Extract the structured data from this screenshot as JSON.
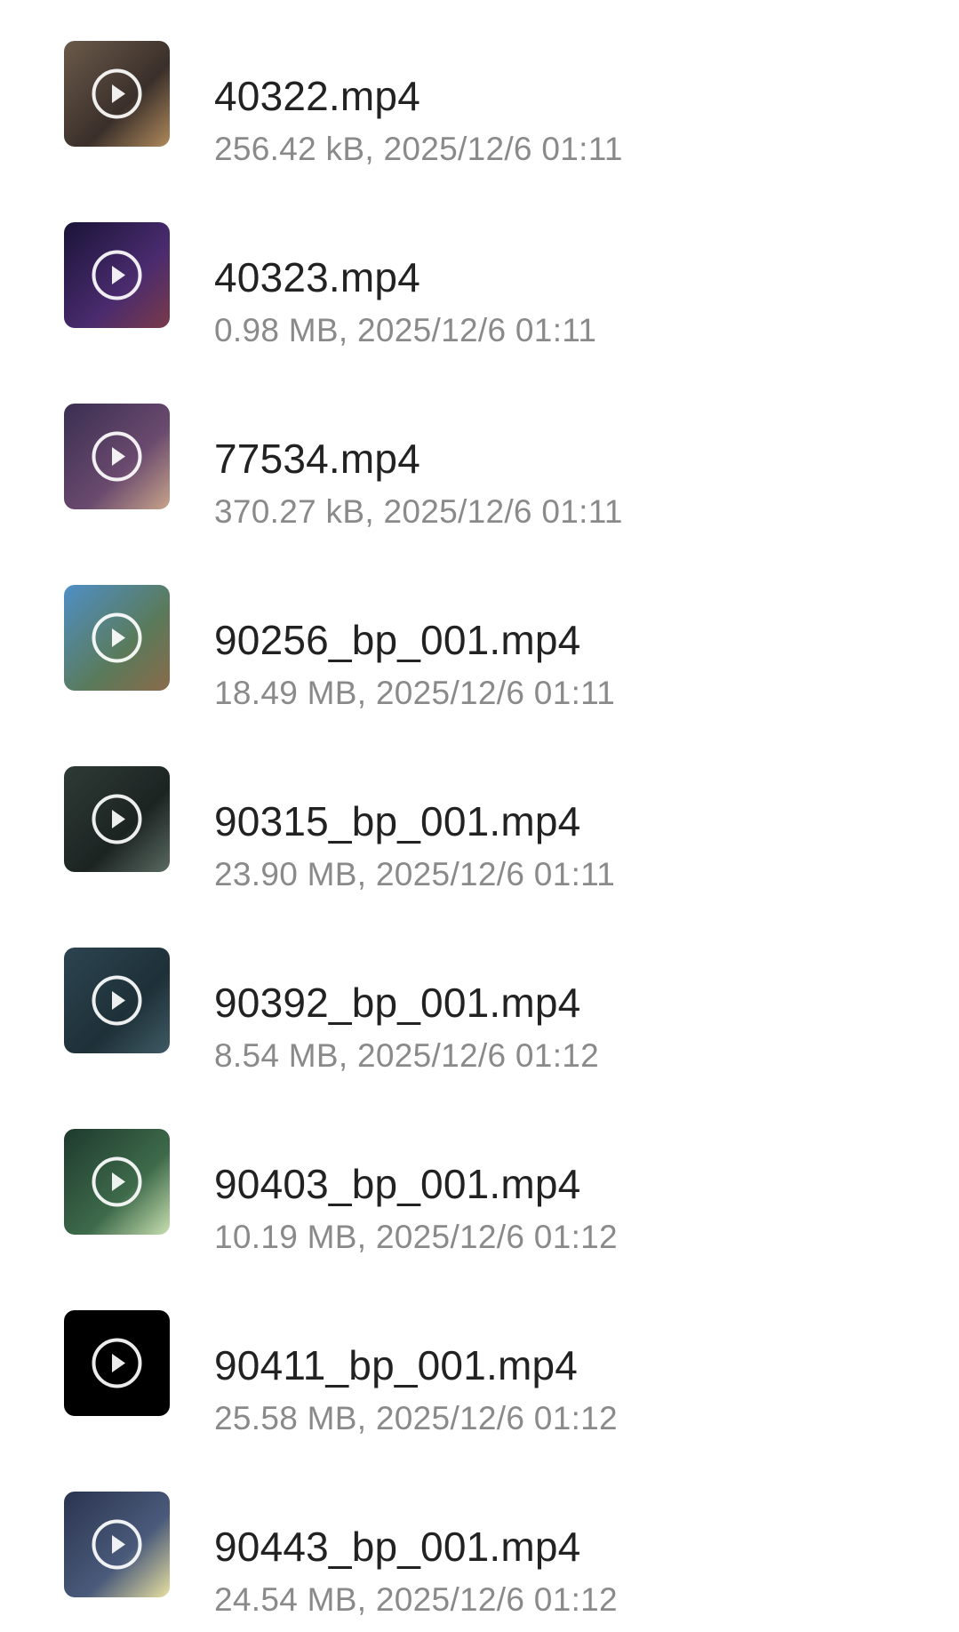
{
  "files": [
    {
      "name": "40322.mp4",
      "meta": "256.42 kB, 2025/12/6 01:11",
      "thumb_icon": "video-thumbnail-icon",
      "thumb_colors": [
        "#6b5a4a",
        "#3a2f2a",
        "#b08a5c"
      ]
    },
    {
      "name": "40323.mp4",
      "meta": "0.98 MB, 2025/12/6 01:11",
      "thumb_icon": "video-thumbnail-icon",
      "thumb_colors": [
        "#1a1438",
        "#4a2b6e",
        "#7a3a4a"
      ]
    },
    {
      "name": "77534.mp4",
      "meta": "370.27 kB, 2025/12/6 01:11",
      "thumb_icon": "video-thumbnail-icon",
      "thumb_colors": [
        "#3a2f52",
        "#6a4a6e",
        "#c9a48a"
      ]
    },
    {
      "name": "90256_bp_001.mp4",
      "meta": "18.49 MB, 2025/12/6 01:11",
      "thumb_icon": "video-thumbnail-icon",
      "thumb_colors": [
        "#4f8fc6",
        "#5a7a5a",
        "#8a6a4a"
      ]
    },
    {
      "name": "90315_bp_001.mp4",
      "meta": "23.90 MB, 2025/12/6 01:11",
      "thumb_icon": "video-thumbnail-icon",
      "thumb_colors": [
        "#2e3a36",
        "#1c2422",
        "#5a6a62"
      ]
    },
    {
      "name": "90392_bp_001.mp4",
      "meta": "8.54 MB, 2025/12/6 01:12",
      "thumb_icon": "video-thumbnail-icon",
      "thumb_colors": [
        "#2c4450",
        "#1e3038",
        "#3e5a64"
      ]
    },
    {
      "name": "90403_bp_001.mp4",
      "meta": "10.19 MB, 2025/12/6 01:12",
      "thumb_icon": "video-thumbnail-icon",
      "thumb_colors": [
        "#1e3a2e",
        "#3e6a4a",
        "#c8e0b0"
      ]
    },
    {
      "name": "90411_bp_001.mp4",
      "meta": "25.58 MB, 2025/12/6 01:12",
      "thumb_icon": "video-thumbnail-icon",
      "thumb_colors": [
        "#000000",
        "#000000",
        "#000000"
      ]
    },
    {
      "name": "90443_bp_001.mp4",
      "meta": "24.54 MB, 2025/12/6 01:12",
      "thumb_icon": "video-thumbnail-icon",
      "thumb_colors": [
        "#2a3450",
        "#4a5a7a",
        "#e8e0a0"
      ]
    }
  ],
  "colors": {
    "background": "#ffffff",
    "title_text": "#222222",
    "meta_text": "#8a8a8a",
    "play_icon": "#ffffff"
  }
}
